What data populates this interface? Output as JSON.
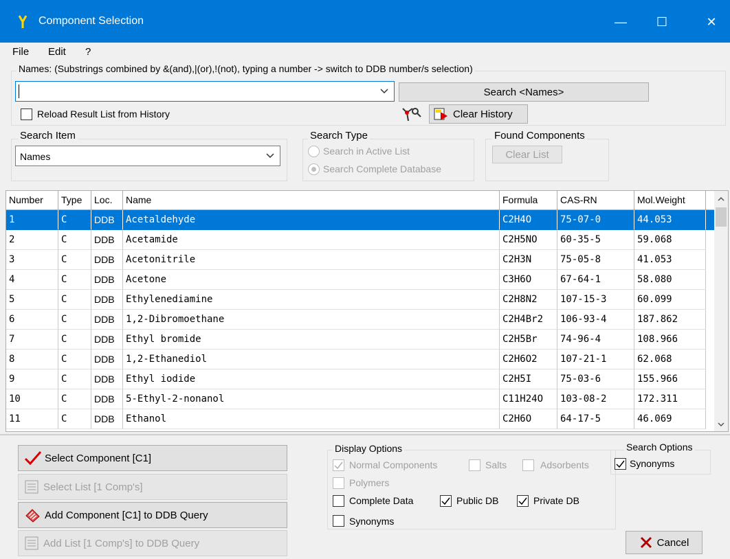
{
  "window": {
    "title": "Component Selection",
    "minimize": "—",
    "maximize": "☐",
    "close": "✕"
  },
  "menu": {
    "file": "File",
    "edit": "Edit",
    "help": "?"
  },
  "names_group": {
    "label": "Names: (Substrings combined by &(and),|(or),!(not), typing a number -> switch to DDB number/s selection)",
    "input_value": "",
    "search_button": "Search <Names>",
    "reload_label": "Reload Result List from History",
    "clear_history": "Clear History"
  },
  "search_item": {
    "label": "Search Item",
    "value": "Names"
  },
  "search_type": {
    "label": "Search Type",
    "option_active": "Search in Active List",
    "option_complete": "Search Complete Database"
  },
  "found_components": {
    "label": "Found Components",
    "clear_list": "Clear List"
  },
  "table": {
    "headers": [
      "Number",
      "Type",
      "Loc.",
      "Name",
      "Formula",
      "CAS-RN",
      "Mol.Weight"
    ],
    "rows": [
      [
        "1",
        "C",
        "DDB",
        "Acetaldehyde",
        "C2H4O",
        "75-07-0",
        "44.053"
      ],
      [
        "2",
        "C",
        "DDB",
        "Acetamide",
        "C2H5NO",
        "60-35-5",
        "59.068"
      ],
      [
        "3",
        "C",
        "DDB",
        "Acetonitrile",
        "C2H3N",
        "75-05-8",
        "41.053"
      ],
      [
        "4",
        "C",
        "DDB",
        "Acetone",
        "C3H6O",
        "67-64-1",
        "58.080"
      ],
      [
        "5",
        "C",
        "DDB",
        "Ethylenediamine",
        "C2H8N2",
        "107-15-3",
        "60.099"
      ],
      [
        "6",
        "C",
        "DDB",
        "1,2-Dibromoethane",
        "C2H4Br2",
        "106-93-4",
        "187.862"
      ],
      [
        "7",
        "C",
        "DDB",
        "Ethyl bromide",
        "C2H5Br",
        "74-96-4",
        "108.966"
      ],
      [
        "8",
        "C",
        "DDB",
        "1,2-Ethanediol",
        "C2H6O2",
        "107-21-1",
        "62.068"
      ],
      [
        "9",
        "C",
        "DDB",
        "Ethyl iodide",
        "C2H5I",
        "75-03-6",
        "155.966"
      ],
      [
        "10",
        "C",
        "DDB",
        "5-Ethyl-2-nonanol",
        "C11H24O",
        "103-08-2",
        "172.311"
      ],
      [
        "11",
        "C",
        "DDB",
        "Ethanol",
        "C2H6O",
        "64-17-5",
        "46.069"
      ]
    ]
  },
  "actions": {
    "select_component": "Select Component [C1]",
    "select_list": "Select List [1 Comp's]",
    "add_component": "Add Component [C1] to DDB Query",
    "add_list": "Add List [1 Comp's] to DDB Query"
  },
  "display_options": {
    "label": "Display Options",
    "normal": "Normal Components",
    "salts": "Salts",
    "adsorbents": "Adsorbents",
    "polymers": "Polymers",
    "complete_data": "Complete Data",
    "public_db": "Public DB",
    "private_db": "Private DB",
    "synonyms": "Synonyms"
  },
  "search_options": {
    "label": "Search Options",
    "synonyms": "Synonyms"
  },
  "cancel": "Cancel"
}
